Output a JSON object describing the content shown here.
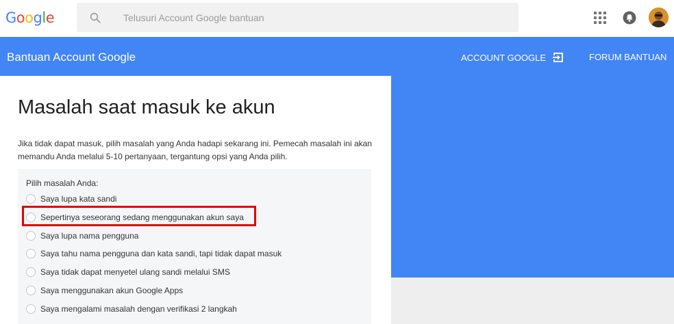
{
  "header": {
    "logo_letters": [
      "G",
      "o",
      "o",
      "g",
      "l",
      "e"
    ],
    "search_placeholder": "Telusuri Account Google bantuan",
    "icons": [
      "search-icon",
      "apps-grid-icon",
      "notifications-bell-icon",
      "avatar"
    ]
  },
  "nav": {
    "brand": "Bantuan Account Google",
    "account_link": "ACCOUNT GOOGLE",
    "forum_link": "FORUM BANTUAN"
  },
  "main": {
    "title": "Masalah saat masuk ke akun",
    "intro": "Jika tidak dapat masuk, pilih masalah yang Anda hadapi sekarang ini. Pemecah masalah ini akan memandu Anda melalui 5-10 pertanyaan, tergantung opsi yang Anda pilih.",
    "options_label": "Pilih masalah Anda:",
    "options": [
      "Saya lupa kata sandi",
      "Sepertinya seseorang sedang menggunakan akun saya",
      "Saya lupa nama pengguna",
      "Saya tahu nama pengguna dan kata sandi, tapi tidak dapat masuk",
      "Saya tidak dapat menyetel ulang sandi melalui SMS",
      "Saya menggunakan akun Google Apps",
      "Saya mengalami masalah dengan verifikasi 2 langkah"
    ],
    "highlighted_option_index": 1
  },
  "colors": {
    "brand_blue": "#4285f4",
    "highlight_red": "#e00000",
    "options_bg": "#f5f6f8"
  }
}
